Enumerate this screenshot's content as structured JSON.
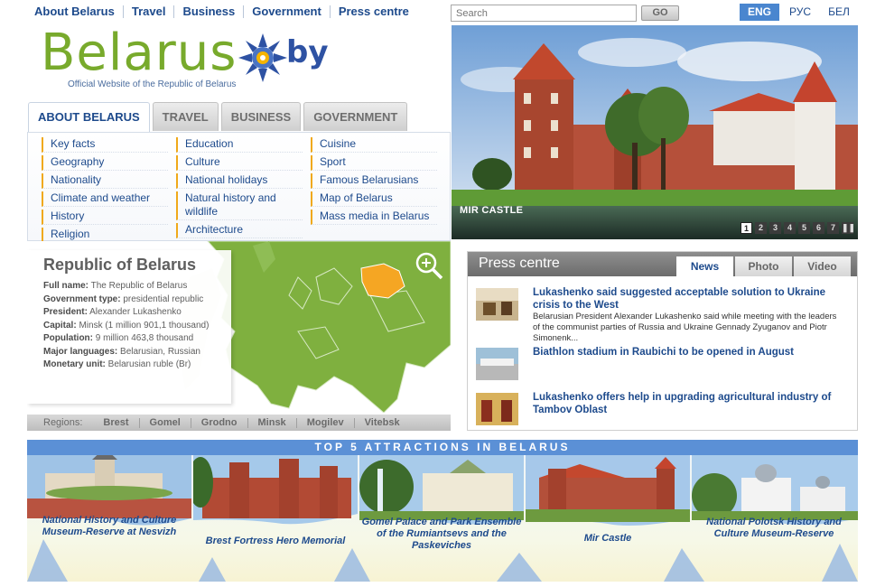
{
  "topnav": [
    "About Belarus",
    "Travel",
    "Business",
    "Government",
    "Press centre"
  ],
  "search": {
    "placeholder": "Search",
    "go": "GO"
  },
  "languages": [
    {
      "label": "ENG",
      "active": true
    },
    {
      "label": "РУС",
      "active": false
    },
    {
      "label": "БЕЛ",
      "active": false
    }
  ],
  "logo": {
    "word": "Belarus",
    "domain": "by",
    "subtitle": "Official Website of the Republic of Belarus"
  },
  "hero": {
    "caption": "MIR CASTLE",
    "pages": [
      "1",
      "2",
      "3",
      "4",
      "5",
      "6",
      "7"
    ],
    "active_page": "1",
    "pause_icon": "pause-icon"
  },
  "main_tabs": [
    {
      "label": "ABOUT BELARUS",
      "active": true
    },
    {
      "label": "TRAVEL",
      "active": false
    },
    {
      "label": "BUSINESS",
      "active": false
    },
    {
      "label": "GOVERNMENT",
      "active": false
    }
  ],
  "links": {
    "col1": [
      "Key facts",
      "Geography",
      "Nationality",
      "Climate and weather",
      "History",
      "Religion"
    ],
    "col2": [
      "Education",
      "Culture",
      "National holidays",
      "Natural history and wildlife",
      "Architecture"
    ],
    "col3": [
      "Cuisine",
      "Sport",
      "Famous Belarusians",
      "Map of Belarus",
      "Mass media in Belarus"
    ]
  },
  "country": {
    "title": "Republic of Belarus",
    "rows": [
      {
        "k": "Full name:",
        "v": " The Republic of Belarus"
      },
      {
        "k": "Government type:",
        "v": " presidential republic"
      },
      {
        "k": "President:",
        "v": " Alexander Lukashenko"
      },
      {
        "k": "Capital:",
        "v": " Minsk (1 million 901,1 thousand)"
      },
      {
        "k": "Population:",
        "v": " 9 million 463,8 thousand"
      },
      {
        "k": "Major languages:",
        "v": " Belarusian, Russian"
      },
      {
        "k": "Monetary unit:",
        "v": " Belarusian ruble (Br)"
      }
    ],
    "zoom_icon": "zoom-in-icon"
  },
  "regions": {
    "label": "Regions:",
    "items": [
      "Brest",
      "Gomel",
      "Grodno",
      "Minsk",
      "Mogilev",
      "Vitebsk"
    ]
  },
  "press": {
    "title": "Press centre",
    "tabs": [
      {
        "label": "News",
        "active": true
      },
      {
        "label": "Photo",
        "active": false
      },
      {
        "label": "Video",
        "active": false
      }
    ],
    "items": [
      {
        "headline": "Lukashenko said suggested acceptable solution to Ukraine crisis to the West",
        "text": "Belarusian President Alexander Lukashenko said while meeting with the leaders of the communist parties of Russia and Ukraine Gennady Zyuganov and Piotr Simonenk..."
      },
      {
        "headline": "Biathlon stadium in Raubichi to be opened in August",
        "text": ""
      },
      {
        "headline": "Lukashenko offers help in upgrading agricultural industry of Tambov Oblast",
        "text": ""
      }
    ]
  },
  "top5": {
    "title": "TOP 5 ATTRACTIONS IN BELARUS",
    "items": [
      "National History and Culture Museum-Reserve at Nesvizh",
      "Brest Fortress Hero Memorial",
      "Gomel Palace and Park Ensemble of the Rumiantsevs and the Paskeviches",
      "Mir Castle",
      "National Polotsk History and Culture Museum-Reserve"
    ]
  },
  "colors": {
    "brand_green": "#78aa2c",
    "brand_blue": "#1d4a8c",
    "accent_orange": "#f0a91a",
    "map_green": "#7fb03f",
    "belarus_orange": "#f5a623"
  }
}
